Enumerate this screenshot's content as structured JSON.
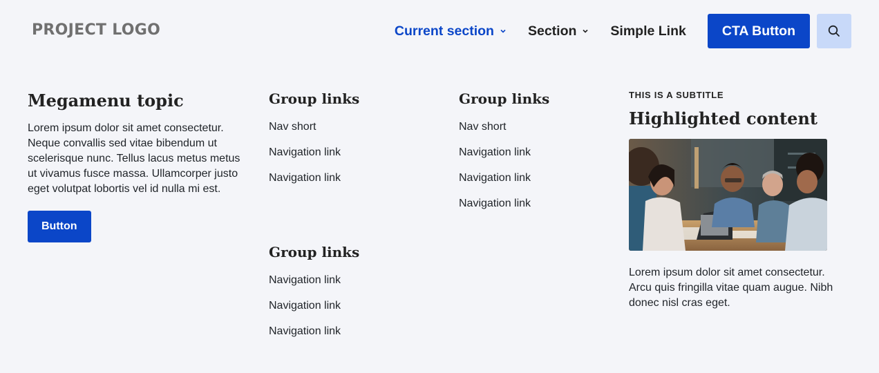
{
  "header": {
    "logo": "PROJECT LOGO",
    "nav": [
      {
        "label": "Current section",
        "has_dropdown": true,
        "current": true
      },
      {
        "label": "Section",
        "has_dropdown": true,
        "current": false
      },
      {
        "label": "Simple Link",
        "has_dropdown": false,
        "current": false
      }
    ],
    "cta_label": "CTA Button",
    "search_icon": "search-icon"
  },
  "megamenu": {
    "topic": {
      "title": "Megamenu topic",
      "description": "Lorem ipsum dolor sit amet consectetur. Neque convallis sed vitae bibendum ut scelerisque nunc. Tellus lacus metus metus ut vivamus fusce massa. Ullamcorper justo eget volutpat lobortis vel id nulla mi est.",
      "button_label": "Button"
    },
    "groups": [
      {
        "title": "Group links",
        "links": [
          "Nav short",
          "Navigation link",
          "Navigation link"
        ]
      },
      {
        "title": "Group links",
        "links": [
          "Navigation link",
          "Navigation link",
          "Navigation link"
        ]
      },
      {
        "title": "Group links",
        "links": [
          "Nav short",
          "Navigation link",
          "Navigation link",
          "Navigation link"
        ]
      }
    ],
    "highlight": {
      "subtitle": "This is a subtitle",
      "title": "Highlighted content",
      "image_subject": "team-meeting-photo",
      "description": "Lorem ipsum dolor sit amet consectetur. Arcu quis fringilla vitae quam augue. Nibh donec nisl cras eget."
    }
  },
  "colors": {
    "accent": "#0b46c8",
    "background": "#f4f5f9",
    "search_button_bg": "#c8d9f9",
    "logo": "#707070"
  }
}
